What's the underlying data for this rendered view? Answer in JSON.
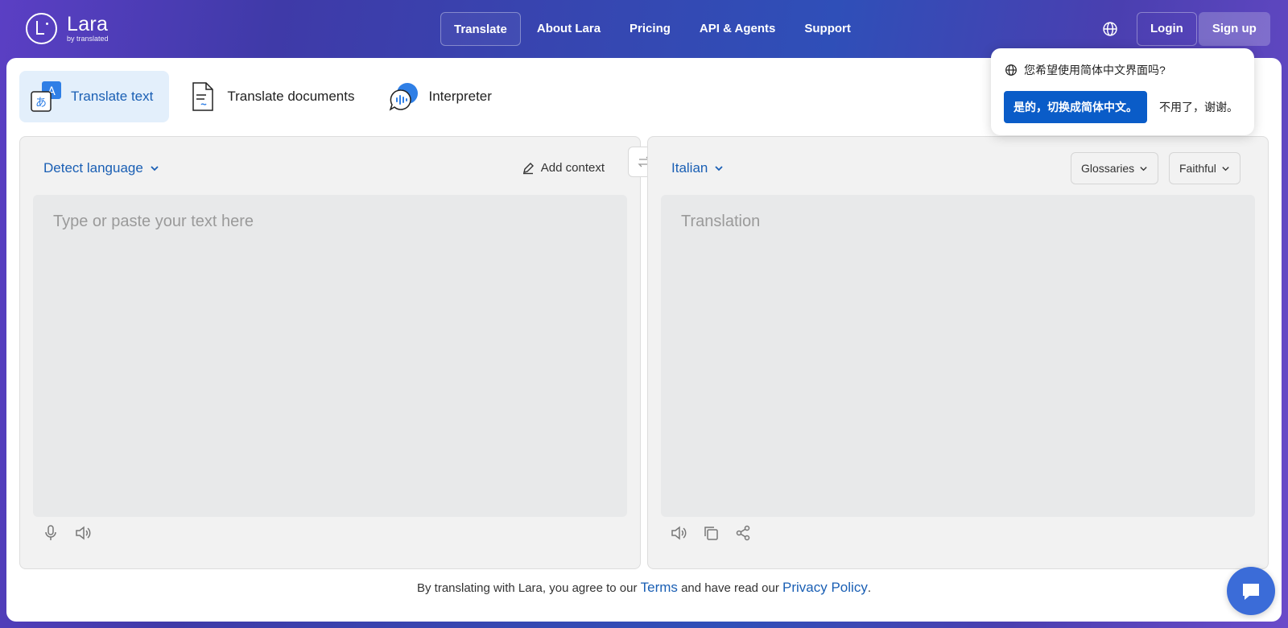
{
  "logo": {
    "name": "Lara",
    "sub": "by translated"
  },
  "nav": {
    "items": [
      {
        "label": "Translate"
      },
      {
        "label": "About Lara"
      },
      {
        "label": "Pricing"
      },
      {
        "label": "API & Agents"
      },
      {
        "label": "Support"
      }
    ],
    "login": "Login",
    "signup": "Sign up"
  },
  "modes": [
    {
      "label": "Translate text",
      "icon": "translate-text-icon"
    },
    {
      "label": "Translate documents",
      "icon": "document-icon"
    },
    {
      "label": "Interpreter",
      "icon": "interpreter-icon"
    }
  ],
  "source": {
    "language": "Detect language",
    "add_context": "Add context",
    "placeholder": "Type or paste your text here"
  },
  "target": {
    "language": "Italian",
    "glossaries": "Glossaries",
    "style": "Faithful",
    "placeholder": "Translation"
  },
  "footer": {
    "prefix": "By translating with Lara, you agree to our ",
    "terms": "Terms",
    "middle": " and have read our ",
    "privacy": "Privacy Policy",
    "suffix": "."
  },
  "popup": {
    "question": "您希望使用简体中文界面吗?",
    "yes": "是的，切换成简体中文。",
    "no": "不用了，谢谢。"
  },
  "colors": {
    "accent": "#1a5fb4",
    "primary_button": "#0a5cc8",
    "chat": "#3b6cd8"
  }
}
